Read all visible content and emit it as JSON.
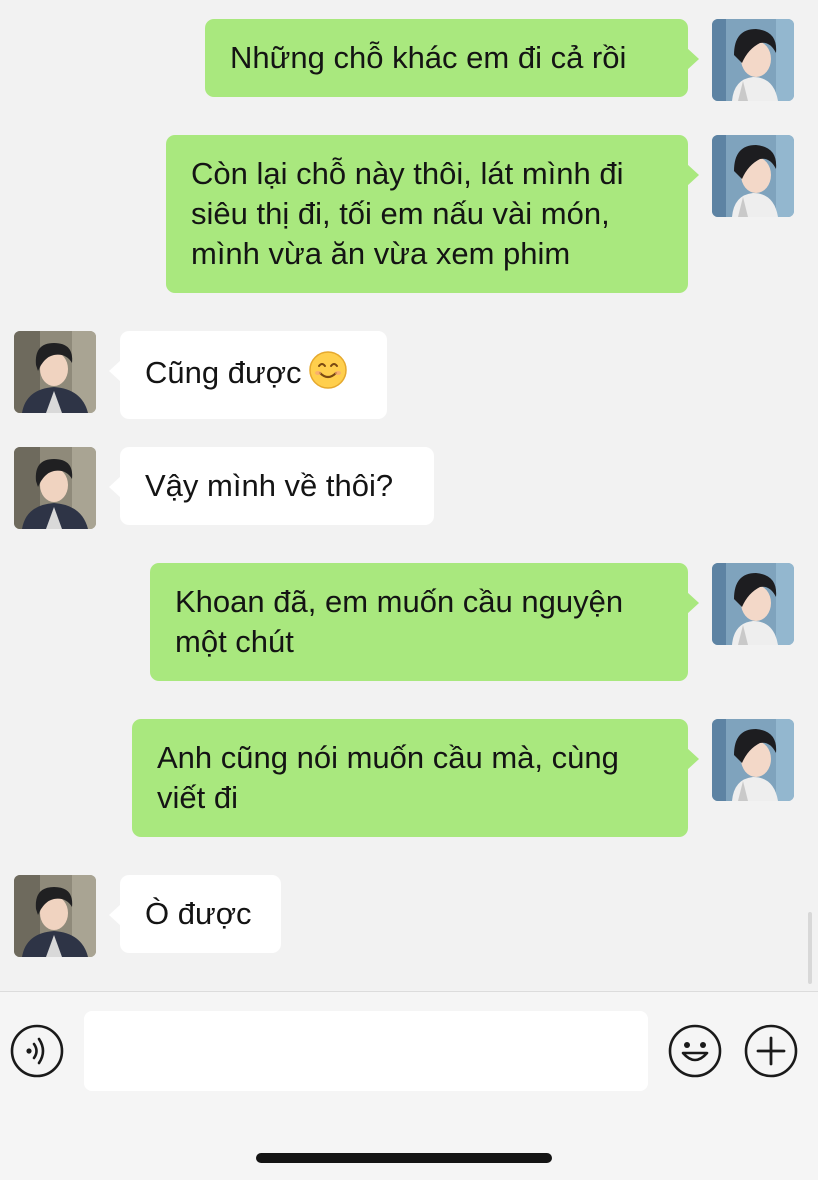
{
  "messages": [
    {
      "sender": "me",
      "text": "Những chỗ khác em đi cả rồi"
    },
    {
      "sender": "me",
      "text": "Còn lại chỗ này thôi, lát mình đi siêu thị đi, tối em nấu vài món, mình vừa ăn vừa xem phim"
    },
    {
      "sender": "them",
      "text": "Cũng được",
      "emoji": "smiling-face-emoji"
    },
    {
      "sender": "them",
      "text": "Vậy mình về thôi?"
    },
    {
      "sender": "me",
      "text": "Khoan đã, em muốn cầu nguyện một chút"
    },
    {
      "sender": "me",
      "text": "Anh cũng nói muốn cầu mà, cùng viết đi"
    },
    {
      "sender": "them",
      "text": "Ò được"
    }
  ],
  "input_bar": {
    "voice_icon": "voice-icon",
    "text_value": "",
    "emoji_icon": "emoji-face-icon",
    "add_icon": "plus-circle-icon"
  },
  "colors": {
    "background": "#f2f2f2",
    "my_bubble": "#a9e87e",
    "their_bubble": "#ffffff",
    "text": "#141414"
  }
}
